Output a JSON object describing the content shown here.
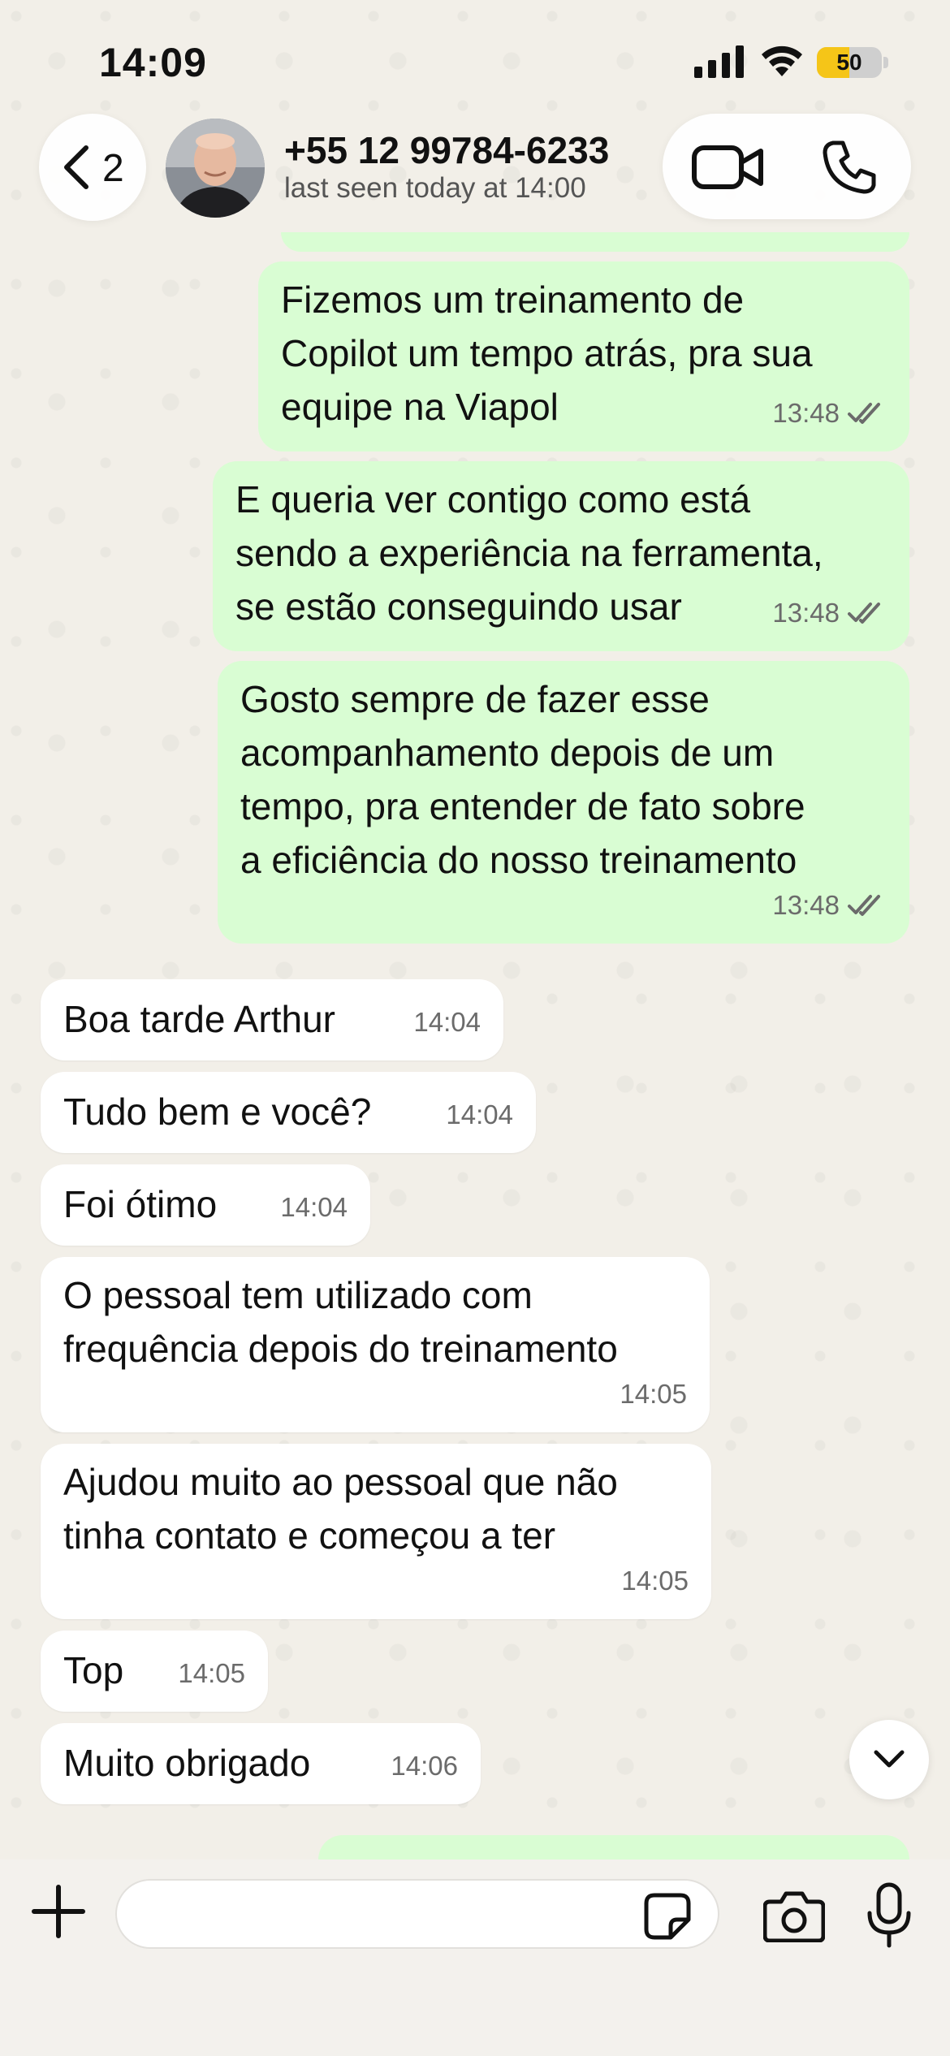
{
  "status_bar": {
    "time": "14:09",
    "battery": "50",
    "battery_fraction": 0.5,
    "icons": [
      "signal-icon",
      "wifi-icon",
      "battery-icon"
    ]
  },
  "header": {
    "back_count": "2",
    "contact_name": "+55 12 99784-6233",
    "contact_status": "last seen today at 14:00",
    "icons": [
      "back-chevron-icon",
      "video-call-icon",
      "phone-call-icon"
    ]
  },
  "messages": [
    {
      "direction": "out",
      "text": "Fizemos um treinamento de\nCopilot um tempo atrás, pra sua\nequipe na Viapol",
      "time": "13:48",
      "status": "read"
    },
    {
      "direction": "out",
      "text": "E queria ver contigo como está\nsendo a experiência na ferramenta,\nse estão conseguindo usar",
      "time": "13:48",
      "status": "read"
    },
    {
      "direction": "out",
      "text": "Gosto sempre de fazer esse\nacompanhamento depois de um\ntempo, pra entender de fato sobre\na eficiência do nosso treinamento",
      "time": "13:48",
      "status": "read"
    },
    {
      "direction": "in",
      "text": "Boa tarde Arthur",
      "time": "14:04"
    },
    {
      "direction": "in",
      "text": "Tudo bem e você?",
      "time": "14:04"
    },
    {
      "direction": "in",
      "text": "Foi ótimo",
      "time": "14:04"
    },
    {
      "direction": "in",
      "text": "O pessoal tem utilizado com\nfrequência depois do treinamento",
      "time": "14:05"
    },
    {
      "direction": "in",
      "text": "Ajudou muito ao pessoal que não\ntinha contato e começou a ter",
      "time": "14:05"
    },
    {
      "direction": "in",
      "text": "Top",
      "time": "14:05"
    },
    {
      "direction": "in",
      "text": "Muito obrigado",
      "time": "14:06"
    }
  ],
  "input_bar": {
    "placeholder": "",
    "icons": [
      "plus-icon",
      "sticker-icon",
      "camera-icon",
      "microphone-icon"
    ]
  },
  "colors": {
    "outgoing_bubble": "#d9fdd3",
    "incoming_bubble": "#ffffff",
    "background": "#f2efe8",
    "battery": "#f5c518"
  }
}
